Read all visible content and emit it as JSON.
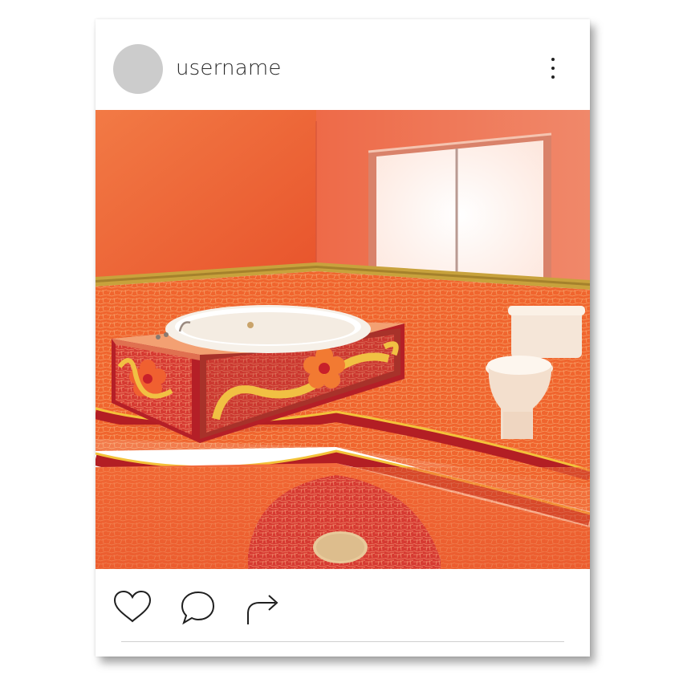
{
  "post": {
    "username": "username",
    "avatar_color": "#cccccc",
    "menu_icon": "more-vertical-icon"
  },
  "actions": {
    "like_icon": "heart-icon",
    "comment_icon": "comment-bubble-icon",
    "share_icon": "share-arrow-icon"
  },
  "colors": {
    "wall": "#ee5a32",
    "tile_orange": "#f06a30",
    "tile_red": "#c8202a",
    "accent_yellow": "#f3c23a",
    "divider": "#cfcfcf"
  }
}
